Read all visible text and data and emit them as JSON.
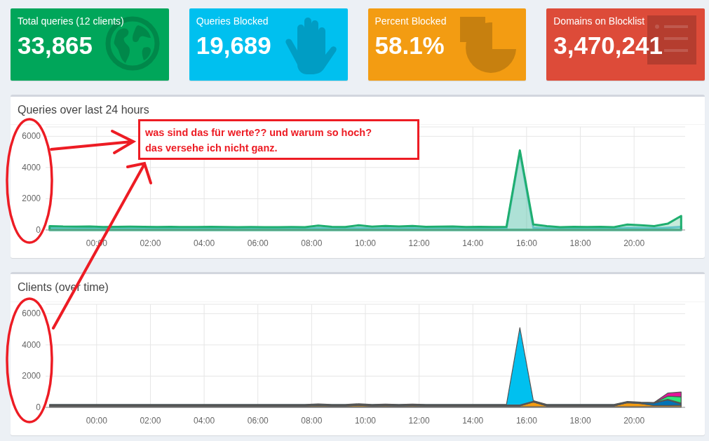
{
  "stat_cards": [
    {
      "kind": "queries",
      "color": "#00a65a",
      "label": "Total queries (12 clients)",
      "value": "33,865"
    },
    {
      "kind": "blocked",
      "color": "#00c0ef",
      "label": "Queries Blocked",
      "value": "19,689"
    },
    {
      "kind": "percent",
      "color": "#f39c12",
      "label": "Percent Blocked",
      "value": "58.1%"
    },
    {
      "kind": "domains",
      "color": "#dd4b39",
      "label": "Domains on Blocklist",
      "value": "3,470,241"
    }
  ],
  "charts": [
    {
      "title": "Queries over last 24 hours",
      "chart_data": {
        "type": "area",
        "stacked": false,
        "grid": true,
        "x": [
          -1.75,
          -1.25,
          -0.75,
          -0.25,
          0.25,
          0.75,
          1.25,
          1.75,
          2.25,
          2.75,
          3.25,
          3.75,
          4.25,
          4.75,
          5.25,
          5.75,
          6.25,
          6.75,
          7.25,
          7.75,
          8.25,
          8.75,
          9.25,
          9.75,
          10.25,
          10.75,
          11.25,
          11.75,
          12.25,
          12.75,
          13.25,
          13.75,
          14.25,
          14.75,
          15.25,
          15.75,
          16.25,
          16.75,
          17.25,
          17.75,
          18.25,
          18.75,
          19.25,
          19.75,
          20.25,
          20.75,
          21.25,
          21.75
        ],
        "xlim": [
          -1.9,
          21.9
        ],
        "ylim": [
          0,
          6600
        ],
        "xticks": [
          {
            "value": 0,
            "label": "00:00"
          },
          {
            "value": 2,
            "label": "02:00"
          },
          {
            "value": 4,
            "label": "04:00"
          },
          {
            "value": 6,
            "label": "06:00"
          },
          {
            "value": 8,
            "label": "08:00"
          },
          {
            "value": 10,
            "label": "10:00"
          },
          {
            "value": 12,
            "label": "12:00"
          },
          {
            "value": 14,
            "label": "14:00"
          },
          {
            "value": 16,
            "label": "16:00"
          },
          {
            "value": 18,
            "label": "18:00"
          },
          {
            "value": 20,
            "label": "20:00"
          }
        ],
        "yticks": [
          0,
          2000,
          4000,
          6000
        ],
        "series": [
          {
            "color": "#7ccbe4",
            "values": [
              120,
              100,
              100,
              110,
              90,
              100,
              100,
              90,
              90,
              100,
              90,
              90,
              100,
              90,
              80,
              90,
              80,
              80,
              90,
              80,
              120,
              90,
              90,
              130,
              90,
              110,
              100,
              110,
              90,
              100,
              100,
              90,
              90,
              90,
              100,
              4950,
              150,
              110,
              80,
              90,
              90,
              90,
              80,
              150,
              130,
              110,
              150,
              200
            ]
          },
          {
            "color": "#1fae6f",
            "values": [
              250,
              220,
              210,
              230,
              190,
              200,
              210,
              200,
              190,
              200,
              190,
              190,
              200,
              190,
              180,
              190,
              180,
              180,
              190,
              180,
              280,
              200,
              190,
              300,
              210,
              260,
              230,
              260,
              200,
              210,
              220,
              190,
              200,
              190,
              200,
              5100,
              350,
              250,
              180,
              200,
              190,
              200,
              180,
              350,
              300,
              250,
              400,
              900
            ]
          }
        ]
      }
    },
    {
      "title": "Clients (over time)",
      "chart_data": {
        "type": "area",
        "stacked": true,
        "grid": true,
        "x": [
          -1.75,
          -1.25,
          -0.75,
          -0.25,
          0.25,
          0.75,
          1.25,
          1.75,
          2.25,
          2.75,
          3.25,
          3.75,
          4.25,
          4.75,
          5.25,
          5.75,
          6.25,
          6.75,
          7.25,
          7.75,
          8.25,
          8.75,
          9.25,
          9.75,
          10.25,
          10.75,
          11.25,
          11.75,
          12.25,
          12.75,
          13.25,
          13.75,
          14.25,
          14.75,
          15.25,
          15.75,
          16.25,
          16.75,
          17.25,
          17.75,
          18.25,
          18.75,
          19.25,
          19.75,
          20.25,
          20.75,
          21.25,
          21.75
        ],
        "xlim": [
          -1.9,
          21.9
        ],
        "ylim": [
          0,
          6600
        ],
        "xticks": [
          {
            "value": 0,
            "label": "00:00"
          },
          {
            "value": 2,
            "label": "02:00"
          },
          {
            "value": 4,
            "label": "04:00"
          },
          {
            "value": 6,
            "label": "06:00"
          },
          {
            "value": 8,
            "label": "08:00"
          },
          {
            "value": 10,
            "label": "10:00"
          },
          {
            "value": 12,
            "label": "12:00"
          },
          {
            "value": 14,
            "label": "14:00"
          },
          {
            "value": 16,
            "label": "16:00"
          },
          {
            "value": 18,
            "label": "18:00"
          },
          {
            "value": 20,
            "label": "20:00"
          }
        ],
        "yticks": [
          0,
          2000,
          4000,
          6000
        ],
        "series": [
          {
            "color": "#00a65a",
            "values": [
              40,
              40,
              40,
              40,
              40,
              40,
              40,
              40,
              40,
              40,
              40,
              40,
              40,
              40,
              40,
              40,
              40,
              40,
              40,
              40,
              40,
              40,
              40,
              40,
              40,
              40,
              40,
              40,
              40,
              40,
              40,
              40,
              40,
              40,
              40,
              40,
              40,
              40,
              40,
              40,
              40,
              40,
              40,
              40,
              40,
              40,
              40,
              40
            ]
          },
          {
            "color": "#f39c12",
            "values": [
              60,
              60,
              60,
              60,
              60,
              60,
              60,
              60,
              60,
              60,
              60,
              60,
              60,
              60,
              60,
              60,
              60,
              60,
              60,
              60,
              80,
              60,
              60,
              90,
              60,
              70,
              60,
              70,
              60,
              60,
              60,
              60,
              60,
              60,
              60,
              60,
              300,
              60,
              60,
              60,
              60,
              60,
              60,
              250,
              200,
              80,
              80,
              100
            ]
          },
          {
            "color": "#0073b7",
            "values": [
              50,
              50,
              50,
              50,
              50,
              50,
              50,
              50,
              50,
              50,
              50,
              50,
              50,
              50,
              50,
              50,
              50,
              50,
              50,
              50,
              60,
              50,
              50,
              60,
              50,
              60,
              50,
              60,
              50,
              50,
              50,
              50,
              50,
              50,
              50,
              50,
              50,
              50,
              50,
              50,
              50,
              50,
              50,
              50,
              50,
              150,
              350,
              80
            ]
          },
          {
            "color": "#00c0ef",
            "values": [
              40,
              40,
              40,
              40,
              40,
              40,
              40,
              40,
              40,
              40,
              40,
              40,
              40,
              40,
              40,
              40,
              40,
              40,
              40,
              40,
              40,
              40,
              40,
              40,
              40,
              40,
              40,
              40,
              40,
              40,
              40,
              40,
              40,
              40,
              40,
              4950,
              40,
              40,
              40,
              40,
              40,
              40,
              40,
              40,
              40,
              40,
              40,
              60
            ]
          },
          {
            "color": "#2ee879",
            "values": [
              null,
              null,
              null,
              null,
              null,
              null,
              null,
              null,
              null,
              null,
              null,
              null,
              null,
              null,
              null,
              null,
              null,
              null,
              null,
              null,
              null,
              null,
              null,
              null,
              null,
              null,
              null,
              null,
              null,
              null,
              null,
              null,
              null,
              null,
              null,
              null,
              null,
              null,
              null,
              null,
              null,
              null,
              null,
              null,
              null,
              0,
              200,
              400
            ]
          },
          {
            "color": "#e6139b",
            "values": [
              null,
              null,
              null,
              null,
              null,
              null,
              null,
              null,
              null,
              null,
              null,
              null,
              null,
              null,
              null,
              null,
              null,
              null,
              null,
              null,
              null,
              null,
              null,
              null,
              null,
              null,
              null,
              null,
              null,
              null,
              null,
              null,
              null,
              null,
              null,
              null,
              null,
              null,
              null,
              null,
              null,
              null,
              null,
              null,
              null,
              0,
              200,
              300
            ]
          }
        ]
      }
    }
  ],
  "annotation_note": {
    "lines": [
      "was sind das für werte?? und warum so hoch?",
      "das versehe ich nicht ganz."
    ]
  }
}
